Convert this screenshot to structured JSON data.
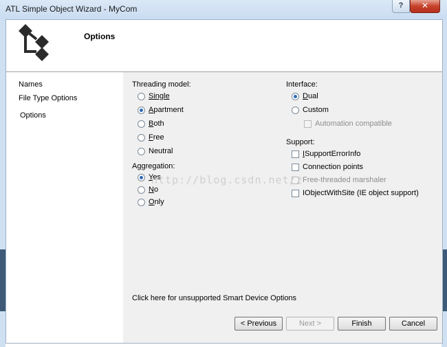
{
  "window": {
    "title": "ATL Simple Object Wizard - MyCom",
    "help_label": "?",
    "close_label": "✕"
  },
  "header": {
    "title": "Options"
  },
  "sidebar": {
    "items": [
      {
        "label": "Names"
      },
      {
        "label": "File Type Options"
      },
      {
        "label": "Options"
      }
    ]
  },
  "threading": {
    "label": "Threading model:",
    "options": [
      {
        "label": "Single",
        "selected": false
      },
      {
        "label": "Apartment",
        "selected": true
      },
      {
        "label": "Both",
        "selected": false
      },
      {
        "label": "Free",
        "selected": false
      },
      {
        "label": "Neutral",
        "selected": false
      }
    ]
  },
  "aggregation": {
    "label": "Aggregation:",
    "options": [
      {
        "label": "Yes",
        "selected": true
      },
      {
        "label": "No",
        "selected": false
      },
      {
        "label": "Only",
        "selected": false
      }
    ]
  },
  "interface": {
    "label": "Interface:",
    "options": [
      {
        "label": "Dual",
        "selected": true
      },
      {
        "label": "Custom",
        "selected": false
      }
    ],
    "automation_label": "Automation compatible"
  },
  "support": {
    "label": "Support:",
    "items": [
      {
        "label": "ISupportErrorInfo",
        "checked": false,
        "enabled": true
      },
      {
        "label": "Connection points",
        "checked": false,
        "enabled": true
      },
      {
        "label": "Free-threaded marshaler",
        "checked": false,
        "enabled": false
      },
      {
        "label": "IObjectWithSite (IE object support)",
        "checked": false,
        "enabled": true
      }
    ]
  },
  "smart_device_link": "Click here for unsupported Smart Device Options",
  "buttons": {
    "previous": "< Previous",
    "next": "Next >",
    "finish": "Finish",
    "cancel": "Cancel"
  },
  "watermark": "http://blog.csdn.net/z"
}
